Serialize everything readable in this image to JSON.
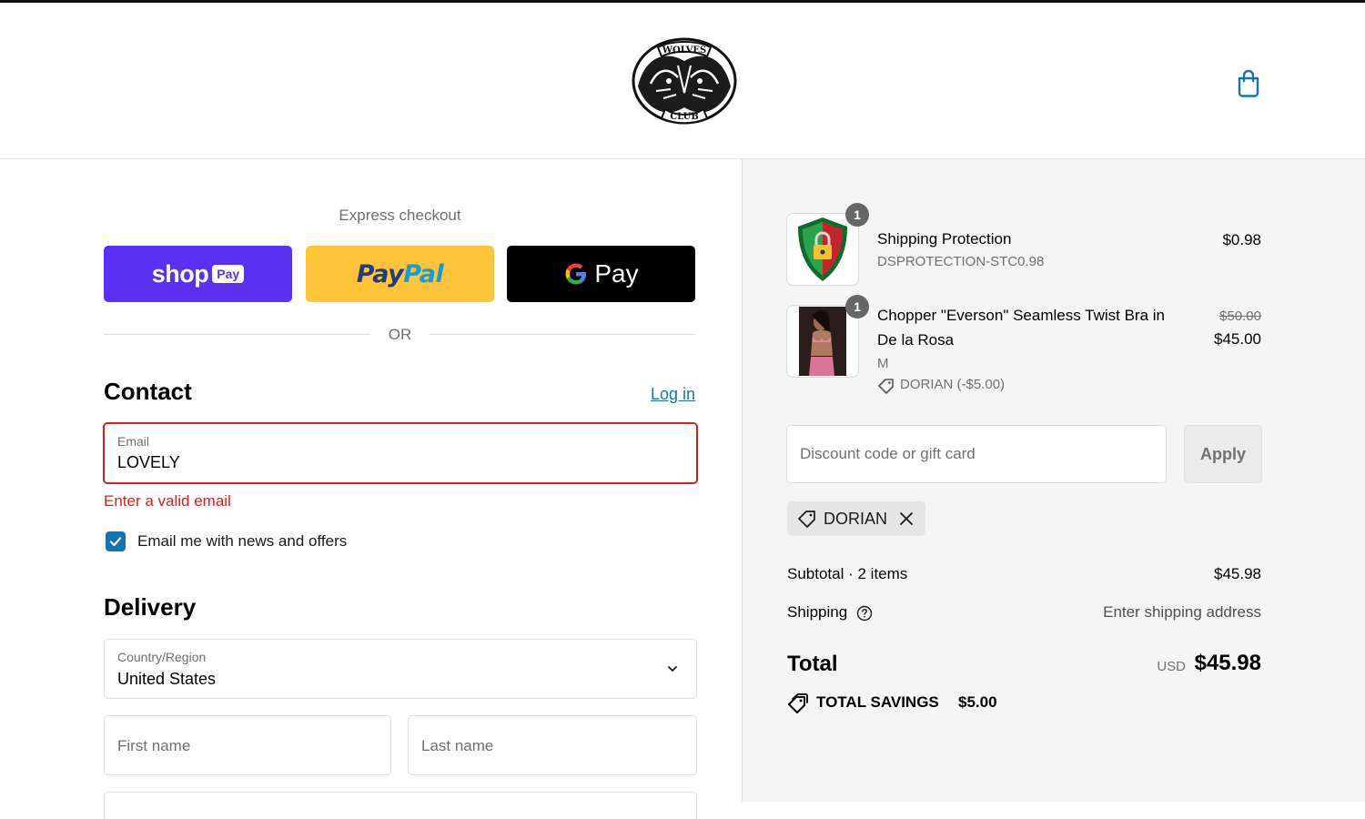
{
  "header": {
    "logo_top_text": "WOLVES",
    "logo_bottom_text": "CLUB",
    "cart_icon": "shopping-bag-icon"
  },
  "express": {
    "title": "Express checkout",
    "shop_pay": {
      "word": "shop",
      "badge": "Pay",
      "color": "#5a31f4"
    },
    "paypal": {
      "part1": "Pay",
      "part2": "Pal",
      "color": "#ffc439"
    },
    "google_pay": {
      "word": "Pay",
      "color": "#000000"
    },
    "or_text": "OR"
  },
  "contact": {
    "heading": "Contact",
    "login_label": "Log in",
    "email_label": "Email",
    "email_value": "LOVELY",
    "error": "Enter a valid email",
    "newsletter_label": "Email me with news and offers",
    "newsletter_checked": true
  },
  "delivery": {
    "heading": "Delivery",
    "country_label": "Country/Region",
    "country_value": "United States",
    "first_name_placeholder": "First name",
    "last_name_placeholder": "Last name"
  },
  "summary": {
    "items": [
      {
        "title": "Shipping Protection",
        "sku": "DSPROTECTION-STC0.98",
        "price": "$0.98",
        "qty": "1"
      },
      {
        "title_line1": "Chopper \"Everson\" Seamless Twist Bra in",
        "title_line2": "De la Rosa",
        "variant": "M",
        "discount": "DORIAN (-$5.00)",
        "old_price": "$50.00",
        "price": "$45.00",
        "qty": "1"
      }
    ],
    "discount_placeholder": "Discount code or gift card",
    "apply_label": "Apply",
    "applied_code": "DORIAN",
    "subtotal_label": "Subtotal · 2 items",
    "subtotal_value": "$45.98",
    "shipping_label": "Shipping",
    "shipping_value": "Enter shipping address",
    "total_label": "Total",
    "total_currency": "USD",
    "total_value": "$45.98",
    "savings_label": "TOTAL SAVINGS",
    "savings_value": "$5.00"
  },
  "colors": {
    "accent": "#1773b0",
    "error": "#dd1d1d",
    "summary_bg": "#f5f5f5"
  }
}
